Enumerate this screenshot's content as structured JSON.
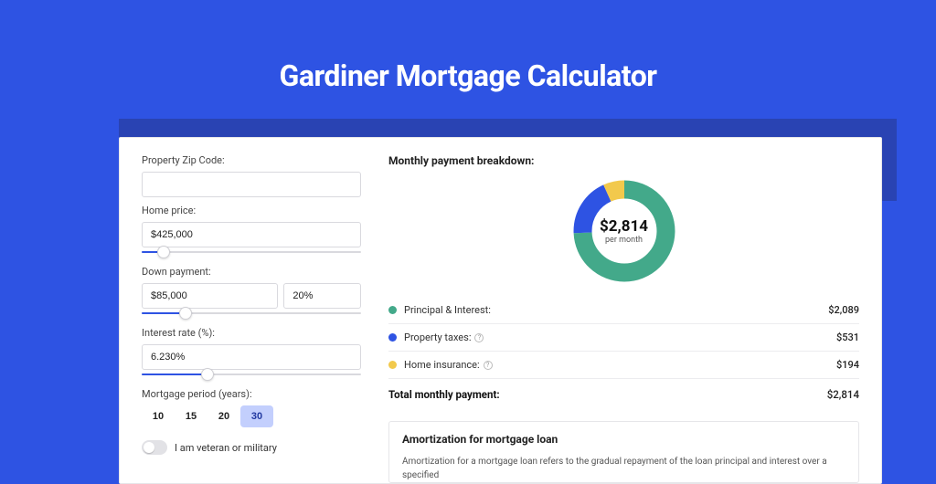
{
  "title": "Gardiner Mortgage Calculator",
  "form": {
    "zip_label": "Property Zip Code:",
    "zip_value": "",
    "home_price_label": "Home price:",
    "home_price_value": "$425,000",
    "home_price_slider_pct": 10,
    "down_payment_label": "Down payment:",
    "down_payment_value": "$85,000",
    "down_payment_pct_value": "20%",
    "down_payment_slider_pct": 20,
    "interest_label": "Interest rate (%):",
    "interest_value": "6.230%",
    "interest_slider_pct": 30,
    "period_label": "Mortgage period (years):",
    "periods": [
      "10",
      "15",
      "20",
      "30"
    ],
    "period_active_index": 3,
    "veteran_label": "I am veteran or military"
  },
  "breakdown": {
    "title": "Monthly payment breakdown:",
    "donut_amount": "$2,814",
    "donut_sub": "per month",
    "items": [
      {
        "color": "green",
        "label": "Principal & Interest:",
        "info": false,
        "value": "$2,089"
      },
      {
        "color": "blue",
        "label": "Property taxes:",
        "info": true,
        "value": "$531"
      },
      {
        "color": "yellow",
        "label": "Home insurance:",
        "info": true,
        "value": "$194"
      }
    ],
    "total_label": "Total monthly payment:",
    "total_value": "$2,814"
  },
  "amortization": {
    "title": "Amortization for mortgage loan",
    "text": "Amortization for a mortgage loan refers to the gradual repayment of the loan principal and interest over a specified"
  },
  "chart_data": {
    "type": "pie",
    "title": "Monthly payment breakdown",
    "series": [
      {
        "name": "Principal & Interest",
        "value": 2089,
        "color": "#43a98a"
      },
      {
        "name": "Property taxes",
        "value": 531,
        "color": "#2e53e3"
      },
      {
        "name": "Home insurance",
        "value": 194,
        "color": "#f2c94c"
      }
    ],
    "total": 2814,
    "center_label": "$2,814 per month"
  }
}
